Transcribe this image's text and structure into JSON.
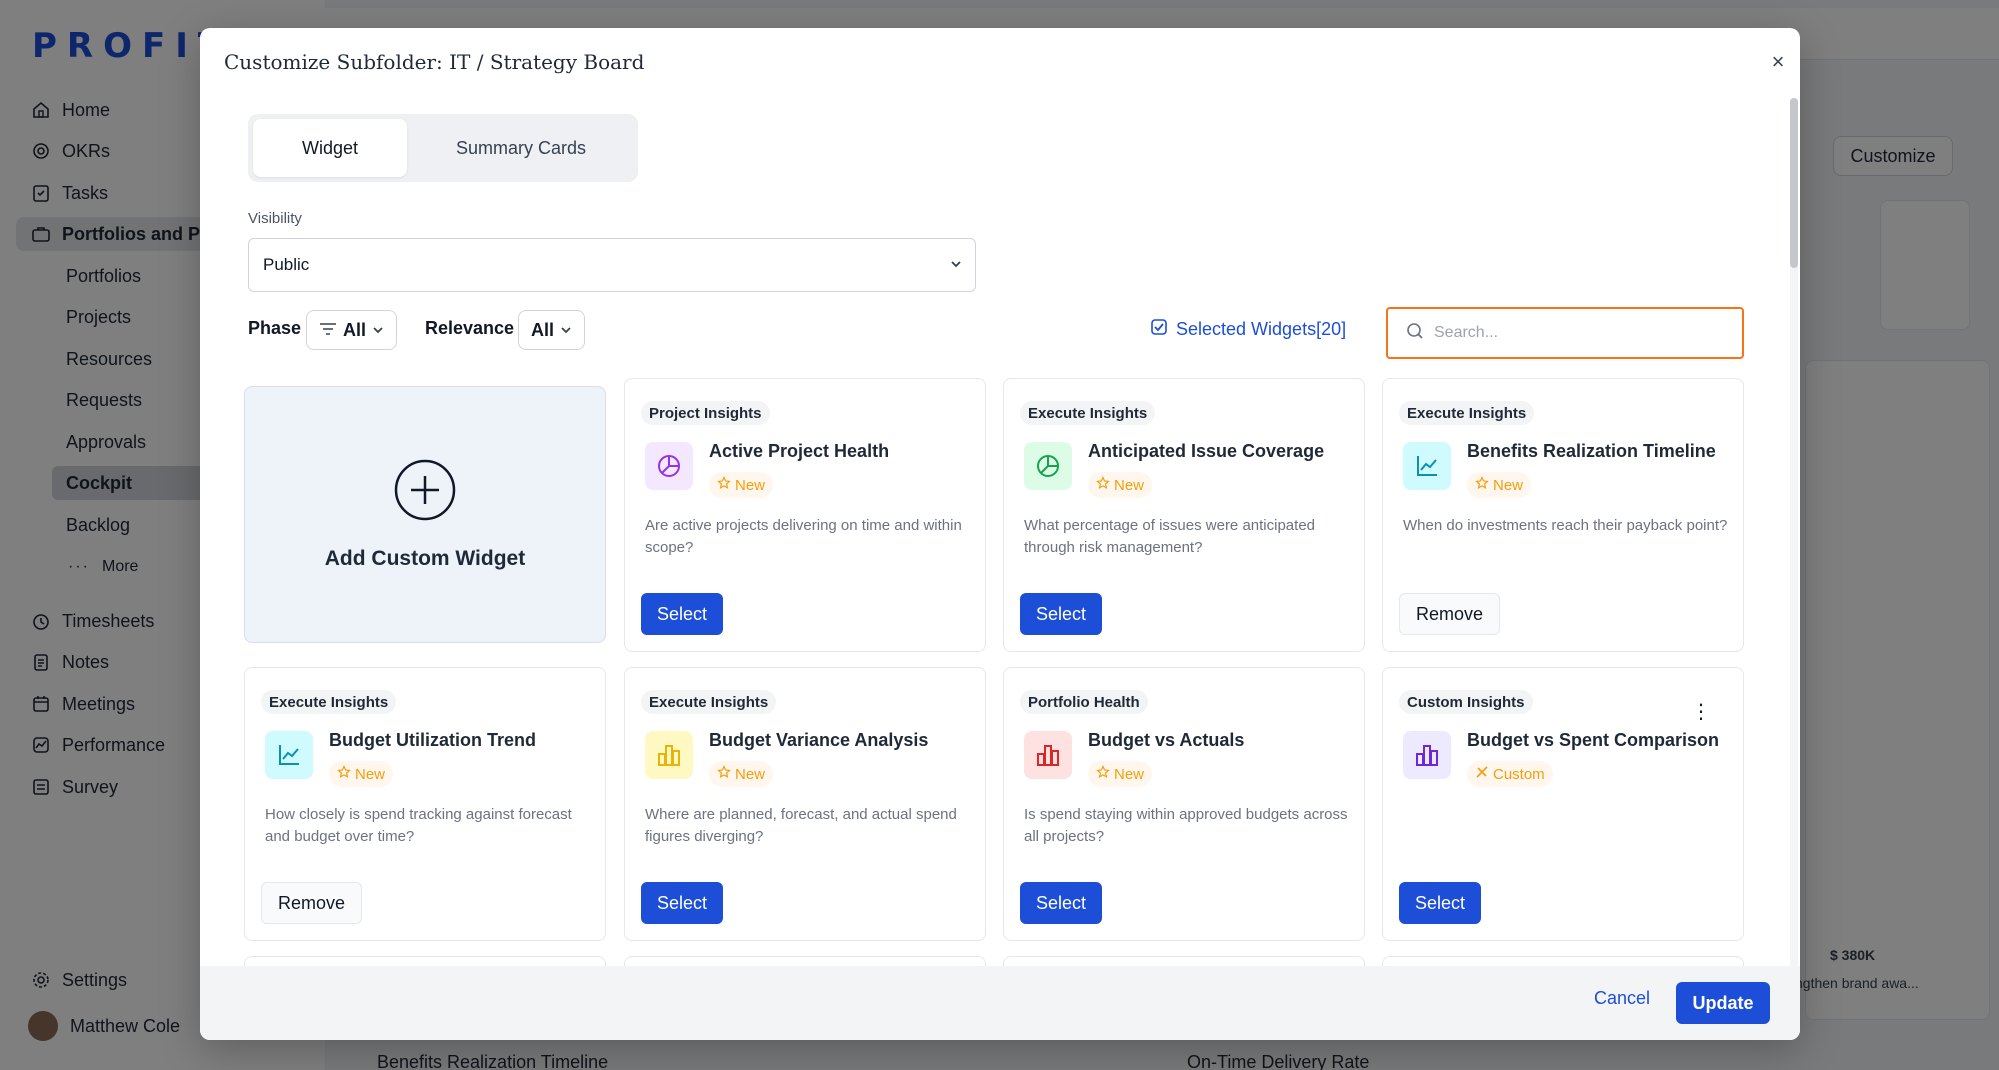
{
  "app": {
    "logo": "PROFIT",
    "nav": [
      {
        "label": "Home",
        "icon": "home-icon"
      },
      {
        "label": "OKRs",
        "icon": "target-icon"
      },
      {
        "label": "Tasks",
        "icon": "tasks-icon"
      },
      {
        "label": "Portfolios and Pr",
        "icon": "folder-icon"
      }
    ],
    "subnav": [
      "Portfolios",
      "Projects",
      "Resources",
      "Requests",
      "Approvals",
      "Cockpit",
      "Backlog"
    ],
    "more": "More",
    "nav2": [
      {
        "label": "Timesheets",
        "icon": "clock-icon"
      },
      {
        "label": "Notes",
        "icon": "notes-icon"
      },
      {
        "label": "Meetings",
        "icon": "calendar-icon"
      },
      {
        "label": "Performance",
        "icon": "performance-icon"
      },
      {
        "label": "Survey",
        "icon": "survey-icon"
      }
    ],
    "settings": "Settings",
    "user": "Matthew Cole",
    "customize": "Customize",
    "bg_value": "$ 380K",
    "bg_caption": "ngthen brand awa...",
    "bg_bottom_left": "Benefits Realization Timeline",
    "bg_bottom_right": "On-Time Delivery Rate"
  },
  "modal": {
    "title": "Customize Subfolder: IT / Strategy Board",
    "close": "×",
    "tabs": [
      "Widget",
      "Summary Cards"
    ],
    "visibility_label": "Visibility",
    "visibility_value": "Public",
    "phase_label": "Phase",
    "phase_value": "All",
    "relevance_label": "Relevance",
    "relevance_value": "All",
    "selected_widgets": "Selected Widgets[20]",
    "search_placeholder": "Search...",
    "add_custom": "Add Custom Widget",
    "cancel": "Cancel",
    "update": "Update"
  },
  "widgets": [
    {
      "category": "Project Insights",
      "title": "Active Project Health",
      "badge": "New",
      "desc": "Are active projects delivering on time and within scope?",
      "action": "Select",
      "icon": "pie-chart-icon",
      "color": "#9333ea",
      "bg": "#f3e8ff"
    },
    {
      "category": "Execute Insights",
      "title": "Anticipated Issue Coverage",
      "badge": "New",
      "desc": "What percentage of issues were anticipated through risk management?",
      "action": "Select",
      "icon": "pie-chart-icon",
      "color": "#16a34a",
      "bg": "#dcfce7"
    },
    {
      "category": "Execute Insights",
      "title": "Benefits Realization Timeline",
      "badge": "New",
      "desc": "When do investments reach their payback point?",
      "action": "Remove",
      "icon": "line-chart-icon",
      "color": "#0891b2",
      "bg": "#cffafe"
    },
    {
      "category": "Execute Insights",
      "title": "Budget Utilization Trend",
      "badge": "New",
      "desc": "How closely is spend tracking against forecast and budget over time?",
      "action": "Remove",
      "icon": "line-chart-icon",
      "color": "#0891b2",
      "bg": "#cffafe"
    },
    {
      "category": "Execute Insights",
      "title": "Budget Variance Analysis",
      "badge": "New",
      "desc": "Where are planned, forecast, and actual spend figures diverging?",
      "action": "Select",
      "icon": "bar-chart-icon",
      "color": "#eab308",
      "bg": "#fef9c3"
    },
    {
      "category": "Portfolio Health",
      "title": "Budget vs Actuals",
      "badge": "New",
      "desc": "Is spend staying within approved budgets across all projects?",
      "action": "Select",
      "icon": "bar-chart-icon",
      "color": "#dc2626",
      "bg": "#fee2e2"
    },
    {
      "category": "Custom Insights",
      "title": "Budget vs Spent Comparison",
      "badge": "Custom",
      "desc": "",
      "action": "Select",
      "icon": "bar-chart-icon",
      "color": "#6d28d9",
      "bg": "#ede9fe"
    }
  ]
}
